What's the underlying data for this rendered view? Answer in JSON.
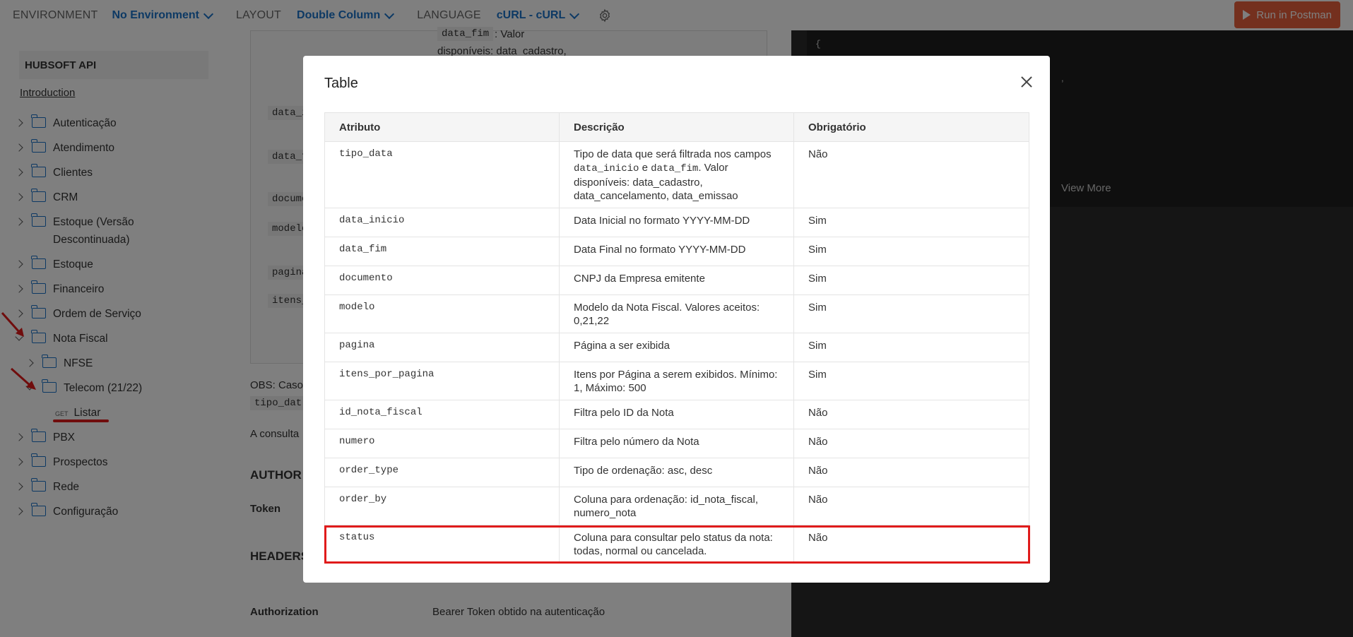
{
  "topbar": {
    "environment_label": "ENVIRONMENT",
    "environment_value": "No Environment",
    "layout_label": "LAYOUT",
    "layout_value": "Double Column",
    "language_label": "LANGUAGE",
    "language_value": "cURL - cURL",
    "run_button": "Run in Postman"
  },
  "sidebar": {
    "api_title": "HUBSOFT API",
    "introduction": "Introduction",
    "items": [
      {
        "label": "Autenticação"
      },
      {
        "label": "Atendimento"
      },
      {
        "label": "Clientes"
      },
      {
        "label": "CRM"
      },
      {
        "label": "Estoque (Versão"
      },
      {
        "label": "Descontinuada)"
      },
      {
        "label": "Estoque"
      },
      {
        "label": "Financeiro"
      },
      {
        "label": "Ordem de Serviço"
      },
      {
        "label": "Nota Fiscal"
      },
      {
        "label": "NFSE"
      },
      {
        "label": "Telecom (21/22)"
      },
      {
        "label": "Listar"
      },
      {
        "label": "PBX"
      },
      {
        "label": "Prospectos"
      },
      {
        "label": "Rede"
      },
      {
        "label": "Configuração"
      }
    ],
    "get_badge": "GET"
  },
  "main": {
    "chip_data_fim": "data_fim",
    "top_text_1": ": Valor",
    "top_text_2": "disponíveis: data_cadastro,",
    "row_chips": [
      "data_i",
      "data_f",
      "docume",
      "modelo",
      "pagina",
      "itens_"
    ],
    "obs": "OBS: Caso",
    "obs_chip": "tipo_dat",
    "consulta": "A consulta",
    "auth_heading": "AUTHOR",
    "token": "Token",
    "headers_heading": "HEADERS",
    "authorization": "Authorization",
    "authorization_desc": "Bearer Token obtido na autenticação"
  },
  "code_panel": {
    "brace": "{",
    "comma": ",",
    "view_more": "View More"
  },
  "modal": {
    "title": "Table",
    "columns": [
      "Atributo",
      "Descrição",
      "Obrigatório"
    ],
    "rows": [
      {
        "attr": "tipo_data",
        "desc_1": "Tipo de data que será filtrada nos campos",
        "desc_code_1": "data_inicio",
        "desc_mid": " e ",
        "desc_code_2": "data_fim",
        "desc_2": ". Valor disponíveis: data_cadastro, data_cancelamento, data_emissao",
        "req": "Não"
      },
      {
        "attr": "data_inicio",
        "desc": "Data Inicial no formato YYYY-MM-DD",
        "req": "Sim"
      },
      {
        "attr": "data_fim",
        "desc": "Data Final no formato YYYY-MM-DD",
        "req": "Sim"
      },
      {
        "attr": "documento",
        "desc": "CNPJ da Empresa emitente",
        "req": "Sim"
      },
      {
        "attr": "modelo",
        "desc": "Modelo da Nota Fiscal. Valores aceitos: 0,21,22",
        "req": "Sim"
      },
      {
        "attr": "pagina",
        "desc": "Página a ser exibida",
        "req": "Sim"
      },
      {
        "attr": "itens_por_pagina",
        "desc": "Itens por Página a serem exibidos. Mínimo: 1, Máximo: 500",
        "req": "Sim"
      },
      {
        "attr": "id_nota_fiscal",
        "desc": "Filtra pelo ID da Nota",
        "req": "Não"
      },
      {
        "attr": "numero",
        "desc": "Filtra pelo número da Nota",
        "req": "Não"
      },
      {
        "attr": "order_type",
        "desc": "Tipo de ordenação: asc, desc",
        "req": "Não"
      },
      {
        "attr": "order_by",
        "desc": "Coluna para ordenação: id_nota_fiscal, numero_nota",
        "req": "Não"
      },
      {
        "attr": "status",
        "desc": "Coluna para consultar pelo status da nota: todas, normal ou cancelada.",
        "req": "Não"
      }
    ]
  },
  "colors": {
    "accent": "#1a73c8",
    "postman": "#e8603c",
    "annotation_red": "#e01b1b",
    "overlay": "rgba(0,0,0,0.5)"
  }
}
